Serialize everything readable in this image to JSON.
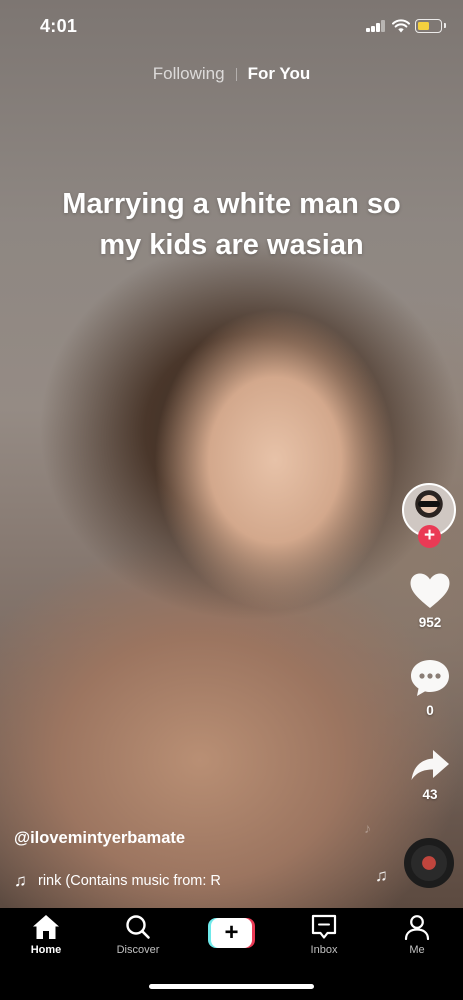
{
  "status_bar": {
    "time": "4:01",
    "icons": [
      "signal-icon",
      "wifi-icon",
      "battery-icon"
    ],
    "battery_color": "#f4d03f"
  },
  "top_tabs": {
    "following": "Following",
    "for_you": "For You",
    "active": "For You"
  },
  "video": {
    "caption_line1": "Marrying a white man so",
    "caption_line2": "my kids are wasian"
  },
  "actions": {
    "follow_symbol": "+",
    "like_count": "952",
    "comment_count": "0",
    "share_count": "43"
  },
  "post": {
    "username": "@ilovemintyerbamate",
    "music": "rink (Contains music from: R"
  },
  "bottom_nav": {
    "home": "Home",
    "discover": "Discover",
    "create_symbol": "+",
    "inbox": "Inbox",
    "me": "Me"
  },
  "colors": {
    "accent_pink": "#ea3a55",
    "accent_cyan": "#6fe9ea",
    "nav_background": "#000000"
  }
}
